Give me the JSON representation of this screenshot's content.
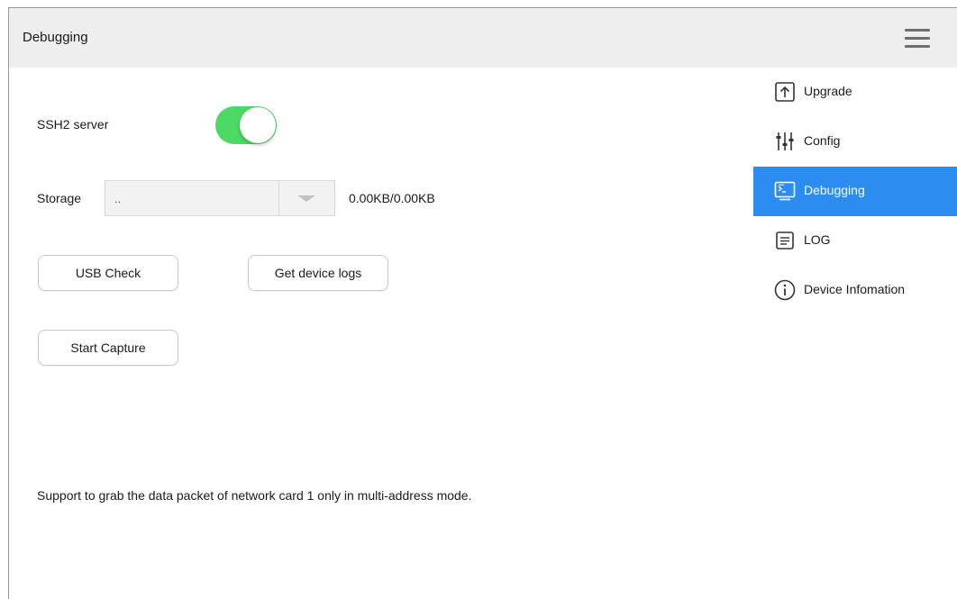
{
  "window": {
    "title": "Debugging"
  },
  "header": {
    "menu_icon": "hamburger-menu-icon"
  },
  "ssh": {
    "label": "SSH2 server",
    "enabled": true,
    "toggle_color": "#4cd964"
  },
  "storage": {
    "label": "Storage",
    "selected": "..",
    "size": "0.00KB/0.00KB"
  },
  "buttons": {
    "usb_check": "USB Check",
    "get_logs": "Get device logs",
    "start_capture": "Start Capture"
  },
  "note": "Support to grab the data packet of network card 1 only in multi-address mode.",
  "sidebar": {
    "active_color": "#2d8cf0",
    "items": [
      {
        "label": "Upgrade",
        "icon": "upgrade-icon",
        "active": false
      },
      {
        "label": "Config",
        "icon": "config-sliders-icon",
        "active": false
      },
      {
        "label": "Debugging",
        "icon": "debugging-terminal-icon",
        "active": true
      },
      {
        "label": "LOG",
        "icon": "log-document-icon",
        "active": false
      },
      {
        "label": "Device Infomation",
        "icon": "info-icon",
        "active": false
      }
    ]
  }
}
